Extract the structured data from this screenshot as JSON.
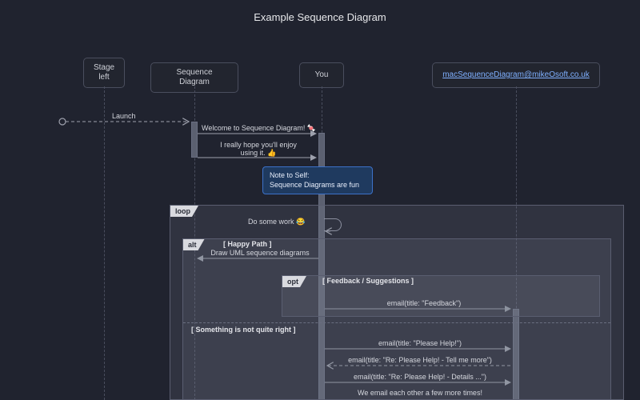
{
  "title": "Example Sequence Diagram",
  "participants": {
    "p1": "Stage\nleft",
    "p2": "Sequence Diagram",
    "p3": "You",
    "p4": "macSequenceDiagram@mikeOsoft.co.uk"
  },
  "messages": {
    "launch": "Launch",
    "welcome": "Welcome to Sequence Diagram! 🍬",
    "hope": "I really hope you'll enjoy\nusing it. 👍",
    "note": "Note to Self:\nSequence Diagrams are fun",
    "work": "Do some work 😂",
    "draw": "Draw UML sequence diagrams",
    "feedback_email": "email(title: \"Feedback\")",
    "help1": "email(title: \"Please Help!\")",
    "help2": "email(title: \"Re: Please Help! - Tell me more\")",
    "help3": "email(title: \"Re: Please Help! - Details ...\")",
    "help4": "We email each other a few more times!"
  },
  "fragments": {
    "loop": "loop",
    "alt": "alt",
    "opt": "opt",
    "guard_happy": "[ Happy Path ]",
    "guard_feedback": "[ Feedback / Suggestions ]",
    "guard_else": "[ Something is not quite right ]"
  }
}
